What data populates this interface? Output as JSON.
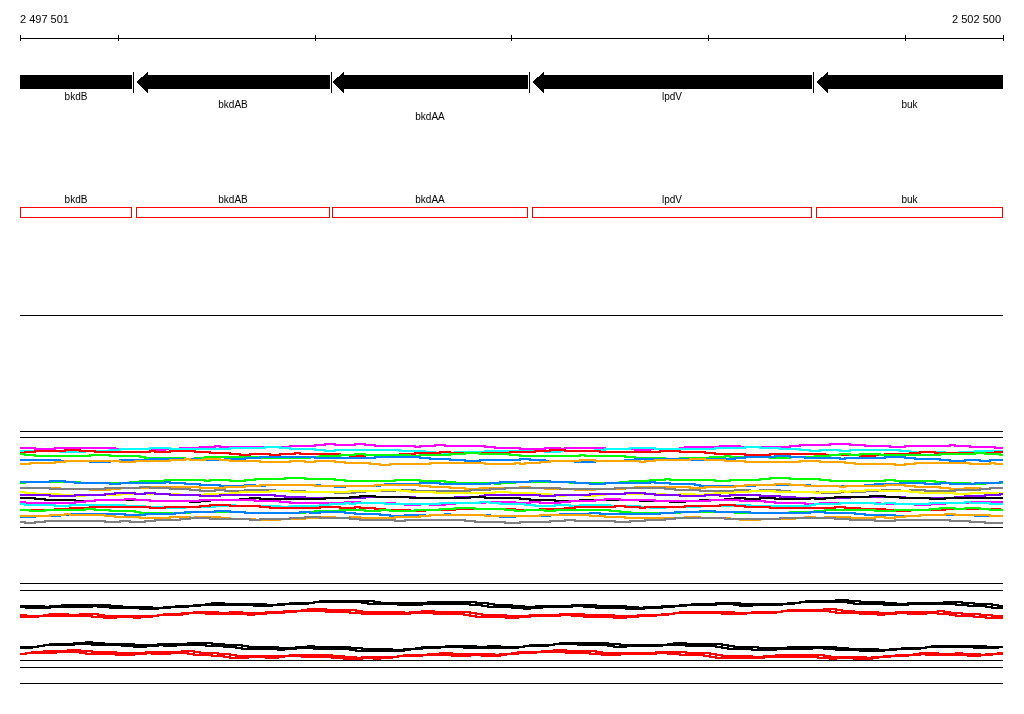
{
  "ruler": {
    "start": "2 497 501",
    "end": "2 502 500"
  },
  "genes": [
    {
      "name": "bkdB",
      "kind": "block"
    },
    {
      "name": "bkdAB",
      "kind": "arrow"
    },
    {
      "name": "bkdAA",
      "kind": "arrow"
    },
    {
      "name": "lpdV",
      "kind": "arrow"
    },
    {
      "name": "buk",
      "kind": "arrow"
    }
  ],
  "features": [
    {
      "name": "bkdB"
    },
    {
      "name": "bkdAB"
    },
    {
      "name": "bkdAA"
    },
    {
      "name": "lpdV"
    },
    {
      "name": "buk"
    }
  ]
}
